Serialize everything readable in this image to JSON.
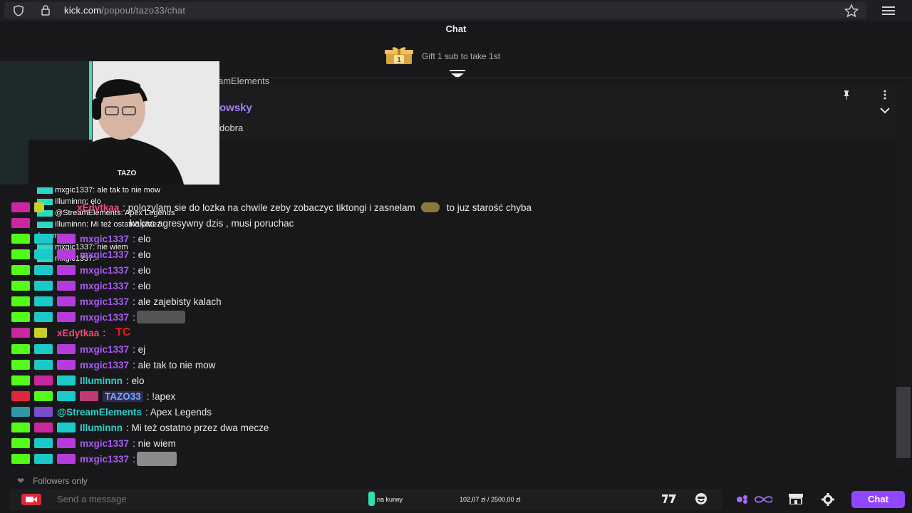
{
  "browser": {
    "url_domain": "kick.com",
    "url_path": "/popout/tazo33/chat"
  },
  "header": {
    "title": "Chat",
    "gift_count": "1",
    "gift_text": "Gift 1 sub to take 1st"
  },
  "pinned": {
    "frag_top": "amElements",
    "frag_user": "owsky",
    "frag_msg": "dobra"
  },
  "webcam": {
    "shirt_text": "TAZO"
  },
  "overlay": [
    {
      "user": "mxgic1337",
      "text": ": ale tak to nie mow"
    },
    {
      "user": "Illuminnn",
      "text": ": elo"
    },
    {
      "user": "@StreamElements",
      "text": ": Apex Legends"
    },
    {
      "user": "Illuminnn",
      "text": ": Mi też ostatno przez"
    },
    {
      "user": "",
      "text": "dwa mecze"
    },
    {
      "user": "mxgic1337",
      "text": ": nie wiem"
    },
    {
      "user": "mxgic1337",
      "text": ":"
    }
  ],
  "messages": [
    {
      "user": "xEdytkaa",
      "text": ": polozylam sie do lozka na chwile zeby zobaczyc tiktongi i zasnelam",
      "text2": "to juz starość chyba"
    },
    {
      "user": "",
      "text": "kakac agresywny dzis , musi poruchac"
    },
    {
      "user": "mxgic1337",
      "text": ": elo"
    },
    {
      "user": "mxgic1337",
      "text": ": elo"
    },
    {
      "user": "mxgic1337",
      "text": ": elo"
    },
    {
      "user": "mxgic1337",
      "text": ": elo"
    },
    {
      "user": "mxgic1337",
      "text": ": ale zajebisty kalach"
    },
    {
      "user": "mxgic1337",
      "text": ":"
    },
    {
      "user": "xEdytkaa",
      "text": ":",
      "emote_text": "TC"
    },
    {
      "user": "mxgic1337",
      "text": ": ej"
    },
    {
      "user": "mxgic1337",
      "text": ": ale tak to nie mow"
    },
    {
      "user": "Illuminnn",
      "text": ": elo"
    },
    {
      "user": "TAZO33",
      "text": ": !apex"
    },
    {
      "user": "@StreamElements",
      "text": ": Apex Legends"
    },
    {
      "user": "Illuminnn",
      "text": ": Mi też ostatno przez dwa mecze"
    },
    {
      "user": "mxgic1337",
      "text": ": nie wiem"
    },
    {
      "user": "mxgic1337",
      "text": ":"
    }
  ],
  "footer": {
    "followers_only": "Followers only",
    "placeholder": "Send a message",
    "goal_label": "na kurwy",
    "goal_amount": "102,07 zł / 2500,00 zł",
    "chat_button": "Chat"
  },
  "colors": {
    "accent": "#9146ff",
    "kick_green": "#53fc18",
    "background": "#18181b"
  }
}
